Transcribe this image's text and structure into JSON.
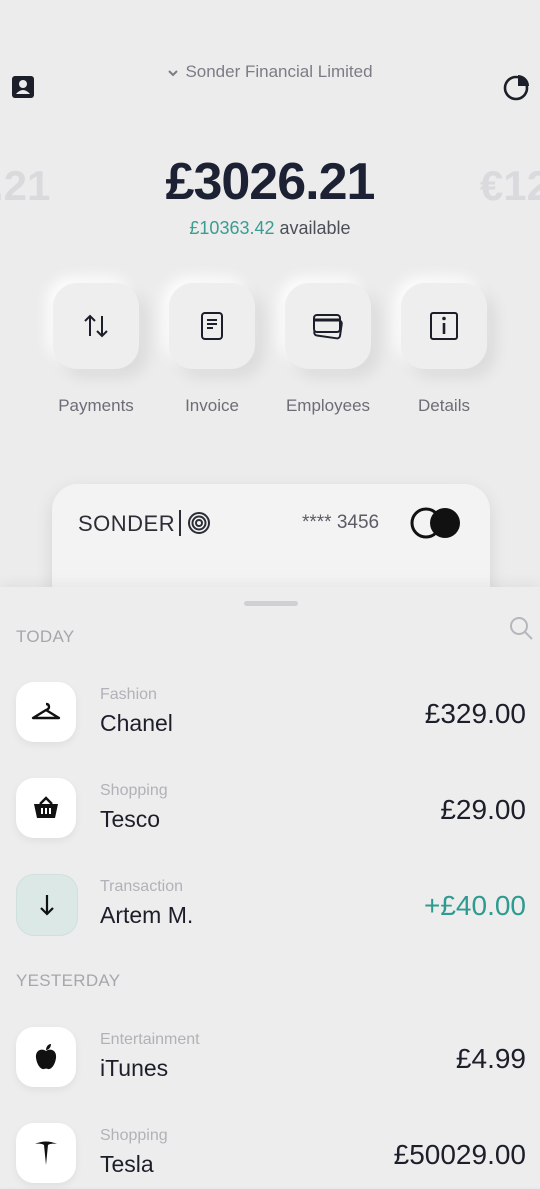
{
  "header": {
    "organization": "Sonder Financial Limited"
  },
  "balance": {
    "ghost_left": ".21",
    "main": "£3026.21",
    "ghost_right": "€12",
    "available_amount": "£10363.42",
    "available_label": "available"
  },
  "actions": [
    {
      "label": "Payments",
      "icon": "arrows-up-down-icon"
    },
    {
      "label": "Invoice",
      "icon": "invoice-document-icon"
    },
    {
      "label": "Employees",
      "icon": "cards-icon"
    },
    {
      "label": "Details",
      "icon": "info-icon"
    }
  ],
  "card": {
    "brand": "SONDER",
    "number": "**** 3456"
  },
  "transactions": {
    "today_label": "TODAY",
    "yesterday_label": "YESTERDAY",
    "today": [
      {
        "category": "Fashion",
        "name": "Chanel",
        "amount": "£329.00",
        "icon": "hanger-icon"
      },
      {
        "category": "Shopping",
        "name": "Tesco",
        "amount": "£29.00",
        "icon": "basket-icon"
      },
      {
        "category": "Transaction",
        "name": "Artem M.",
        "amount": "+£40.00",
        "icon": "arrow-down-icon"
      }
    ],
    "yesterday": [
      {
        "category": "Entertainment",
        "name": "iTunes",
        "amount": "£4.99",
        "icon": "apple-icon"
      },
      {
        "category": "Shopping",
        "name": "Tesla",
        "amount": "£50029.00",
        "icon": "tesla-icon"
      }
    ]
  },
  "colors": {
    "accent": "#3a9c92",
    "positive": "#2d9b8f",
    "text_dark": "#1c2133"
  }
}
